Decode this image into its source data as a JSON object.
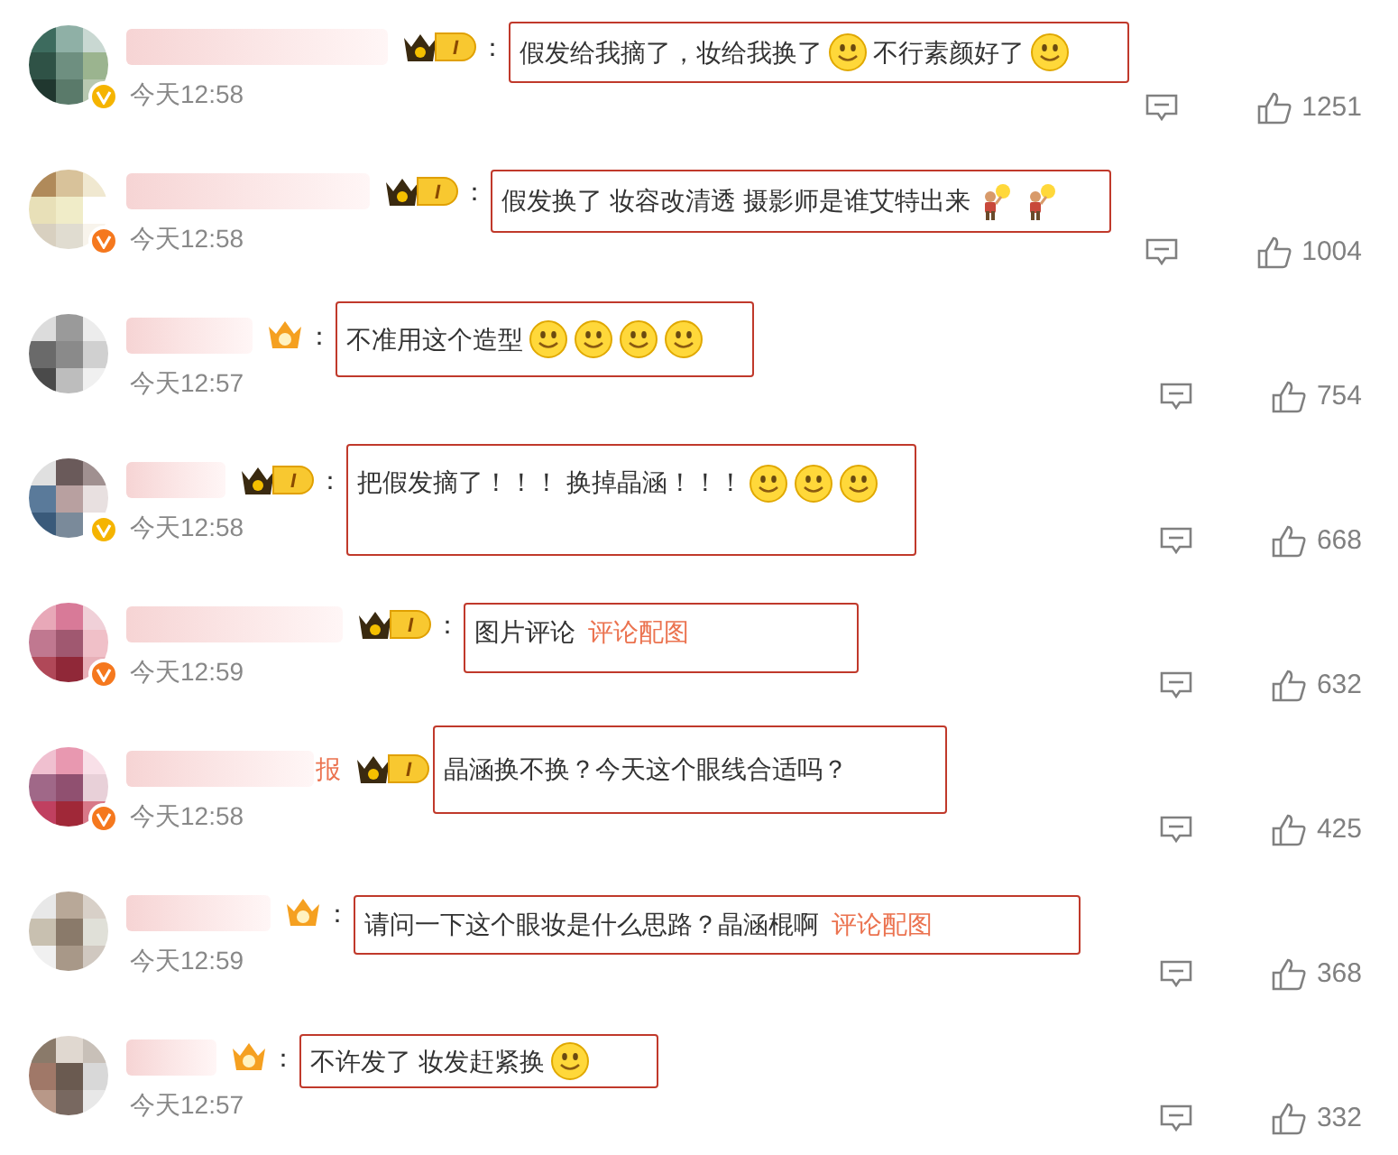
{
  "comments": [
    {
      "verified": {
        "color": "#f5b400"
      },
      "badge": {
        "kind": "crown_level",
        "text": "I"
      },
      "colon": "：",
      "content": [
        {
          "kind": "text",
          "text": "假发给我摘了，妆给我换了"
        },
        {
          "kind": "smile"
        },
        {
          "kind": "text",
          "text": "不行素颜好了"
        },
        {
          "kind": "smile"
        }
      ],
      "time": "今天12:58",
      "likes": "1251"
    },
    {
      "verified": {
        "color": "#f5781e"
      },
      "badge": {
        "kind": "crown_level",
        "text": "I"
      },
      "colon": "：",
      "content": [
        {
          "kind": "text",
          "text": "假发换了 妆容改清透 摄影师是谁艾特出来"
        },
        {
          "kind": "figure"
        },
        {
          "kind": "figure"
        }
      ],
      "time": "今天12:58",
      "likes": "1004"
    },
    {
      "badge": {
        "kind": "crown"
      },
      "colon": "：",
      "content": [
        {
          "kind": "text",
          "text": "不准用这个造型"
        },
        {
          "kind": "smile"
        },
        {
          "kind": "smile"
        },
        {
          "kind": "smile"
        },
        {
          "kind": "smile"
        }
      ],
      "time": "今天12:57",
      "likes": "754"
    },
    {
      "verified": {
        "color": "#f5b400"
      },
      "badge": {
        "kind": "crown_level",
        "text": "I"
      },
      "colon": "：",
      "content": [
        {
          "kind": "text",
          "text": "把假发摘了！！！ 换掉晶涵！！！"
        },
        {
          "kind": "smile"
        },
        {
          "kind": "smile"
        },
        {
          "kind": "smile"
        }
      ],
      "time": "今天12:58",
      "likes": "668"
    },
    {
      "verified": {
        "color": "#f5781e"
      },
      "badge": {
        "kind": "crown_level",
        "text": "I"
      },
      "colon": "：",
      "content": [
        {
          "kind": "text",
          "text": "图片评论"
        },
        {
          "kind": "link",
          "text": "评论配图"
        }
      ],
      "time": "今天12:59",
      "likes": "632"
    },
    {
      "verified": {
        "color": "#f5781e"
      },
      "name_tail": "报",
      "badge": {
        "kind": "crown_level",
        "text": "I"
      },
      "content": [
        {
          "kind": "text",
          "text": "晶涵换不换？今天这个眼线合适吗？"
        }
      ],
      "time": "今天12:58",
      "likes": "425"
    },
    {
      "badge": {
        "kind": "crown"
      },
      "colon": "：",
      "content": [
        {
          "kind": "text",
          "text": "请问一下这个眼妆是什么思路？晶涵棍啊"
        },
        {
          "kind": "link",
          "text": "评论配图"
        }
      ],
      "time": "今天12:59",
      "likes": "368"
    },
    {
      "badge": {
        "kind": "crown"
      },
      "colon": "：",
      "content": [
        {
          "kind": "text",
          "text": "不许发了 妆发赶紧换"
        },
        {
          "kind": "smile"
        }
      ],
      "time": "今天12:57",
      "likes": "332"
    }
  ]
}
